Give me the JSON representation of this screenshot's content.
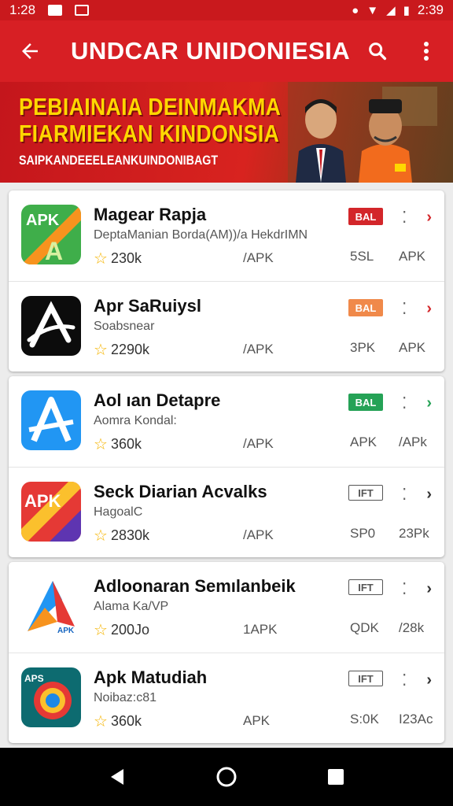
{
  "status_bar": {
    "time": "1:28",
    "battery": "2:39"
  },
  "app_bar": {
    "title": "UNDCAR UNIDONIESIA"
  },
  "banner": {
    "line1": "PEBIAINAIA DEINMAKMA",
    "line2": "FIARMIEKAN KINDONSIA",
    "line3": "SAIPKANDEEELEANKUINDONIBAGT"
  },
  "cards": [
    {
      "rows": [
        {
          "name": "Magear Rapja",
          "sub": "DeptaManian Borda(AM))/a HekdrIMN",
          "rating": "230k",
          "c1": "/APK",
          "c2": "5SL",
          "c3": "APK",
          "badge": "BAL",
          "badge_style": "red",
          "chev_color": "#d3262a",
          "icon": "apk-green"
        },
        {
          "name": "Apr SaRuiysl",
          "sub": "Soabsnear",
          "rating": "2290k",
          "c1": "/APK",
          "c2": "3PK",
          "c3": "APK",
          "badge": "BAL",
          "badge_style": "orange",
          "chev_color": "#d3262a",
          "icon": "a-black"
        }
      ]
    },
    {
      "rows": [
        {
          "name": "Aol ıan Detapre",
          "sub": "Aomra Kondal:",
          "rating": "360k",
          "c1": "/APK",
          "c2": "APK",
          "c3": "/APk",
          "badge": "BAL",
          "badge_style": "green",
          "chev_color": "#25a256",
          "icon": "a-blue"
        },
        {
          "name": "Seck Diarian Acvalks",
          "sub": "HagoalC",
          "rating": "2830k",
          "c1": "/APK",
          "c2": "SP0",
          "c3": "23Pk",
          "badge": "IFT",
          "badge_style": "outline",
          "chev_color": "#333",
          "icon": "apk-red"
        }
      ]
    },
    {
      "rows": [
        {
          "name": "Adloonaran Semılanbeik",
          "sub": "Alama Ka/VP",
          "rating": "200Jo",
          "c1": "1APK",
          "c2": "QDK",
          "c3": "/28k",
          "badge": "IFT",
          "badge_style": "outline",
          "chev_color": "#333",
          "icon": "a-triangle"
        },
        {
          "name": "Apk Matudiah",
          "sub": "Noibaz:c81",
          "rating": "360k",
          "c1": "APK",
          "c2": "S:0K",
          "c3": "I23Ac",
          "badge": "IFT",
          "badge_style": "outline",
          "chev_color": "#333",
          "icon": "apk-swirl"
        }
      ]
    }
  ]
}
